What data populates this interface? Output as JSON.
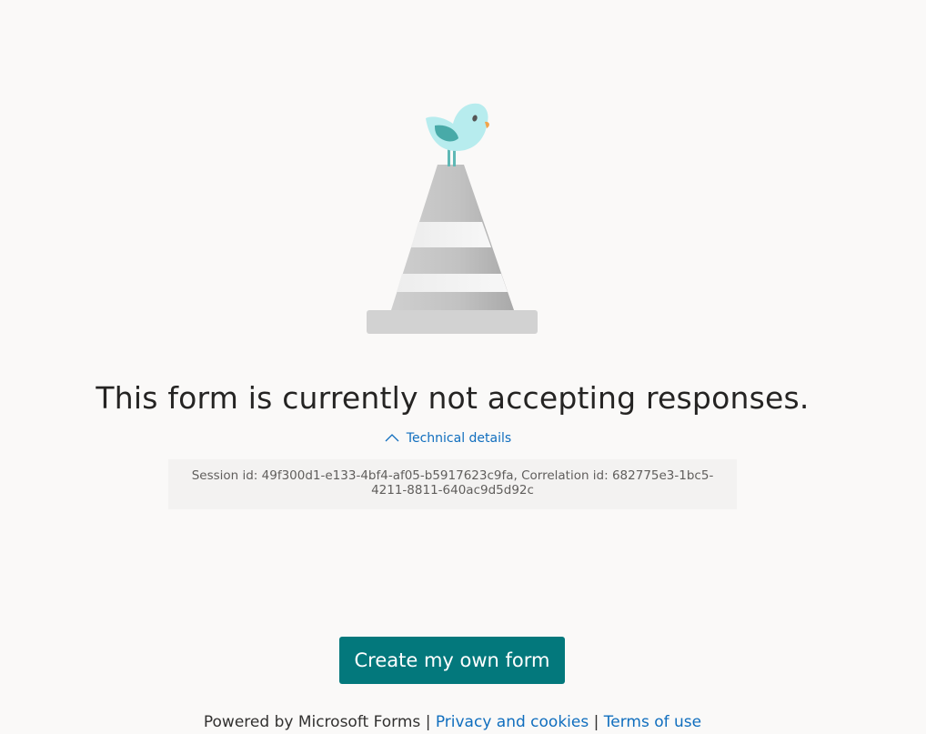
{
  "message": {
    "title": "This form is currently not accepting responses."
  },
  "technical_details": {
    "toggle_label": "Technical details",
    "info": "Session id: 49f300d1-e133-4bf4-af05-b5917623c9fa, Correlation id: 682775e3-1bc5-4211-8811-640ac9d5d92c"
  },
  "actions": {
    "create_label": "Create my own form"
  },
  "footer": {
    "powered_by": "Powered by Microsoft Forms",
    "separator": "|",
    "privacy_label": "Privacy and cookies",
    "terms_label": "Terms of use"
  },
  "colors": {
    "accent": "#03787c",
    "link": "#106ebe",
    "background": "#faf9f8"
  },
  "icons": {
    "illustration": "bird-on-traffic-cone-icon",
    "toggle": "chevron-up-icon"
  }
}
